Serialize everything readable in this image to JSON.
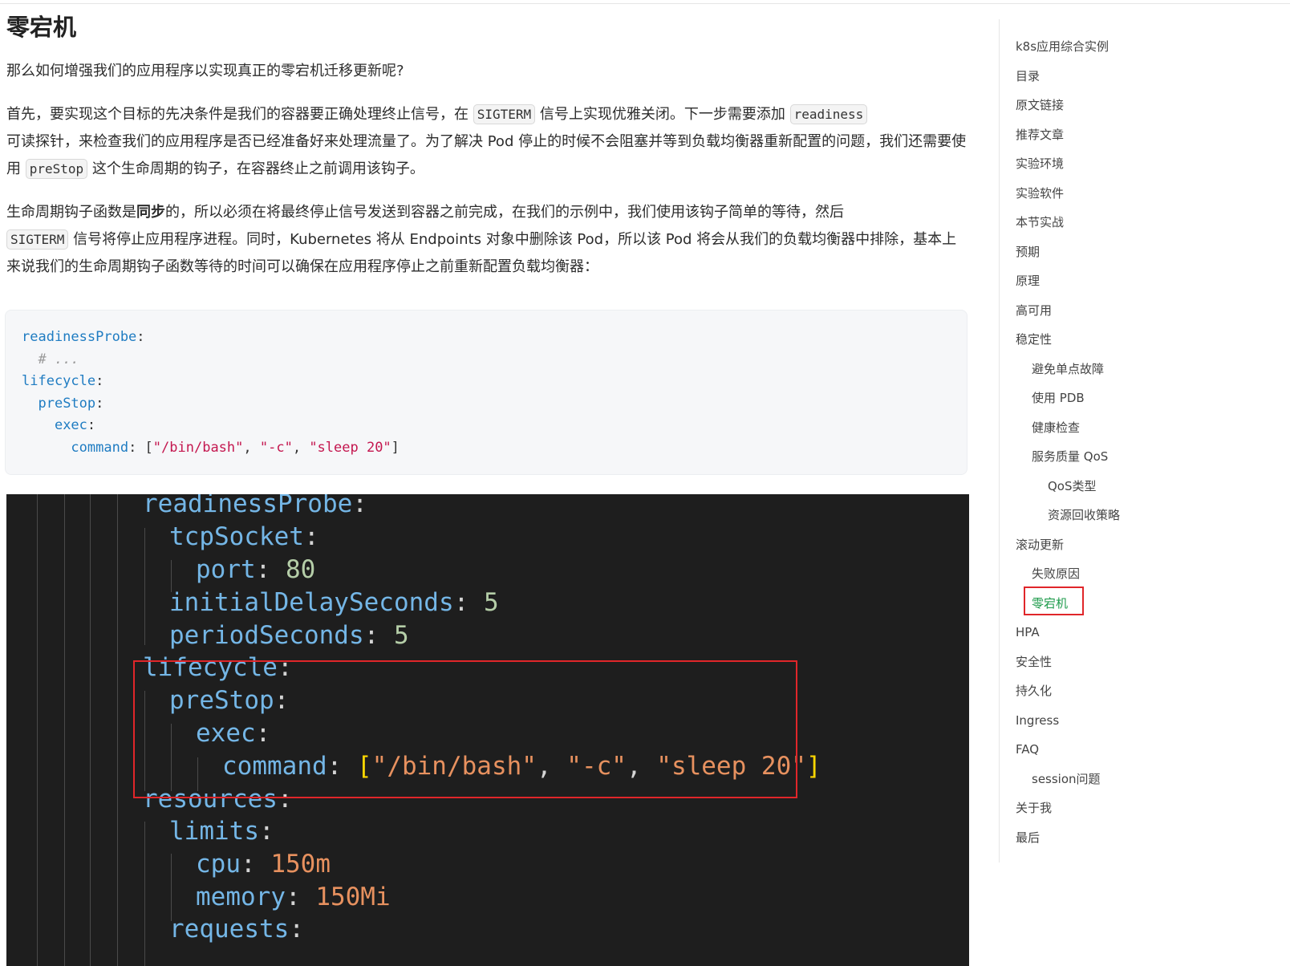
{
  "article": {
    "title": "零宕机",
    "p1": "那么如何增强我们的应用程序以实现真正的零宕机迁移更新呢?",
    "p2": {
      "t1": "首先，要实现这个目标的先决条件是我们的容器要正确处理终止信号，在 ",
      "c1": "SIGTERM",
      "t2": " 信号上实现优雅关闭。下一步需要添加 ",
      "c2": "readiness",
      "t3": "可读探针，来检查我们的应用程序是否已经准备好来处理流量了。为了解决 Pod 停止的时候不会阻塞并等到负载均衡器重新配置的问题，我们还需要使用 ",
      "c3": "preStop",
      "t4": " 这个生命周期的钩子，在容器终止之前调用该钩子。"
    },
    "p3": {
      "t1": "生命周期钩子函数是",
      "bold": "同步",
      "t2": "的，所以必须在将最终停止信号发送到容器之前完成，在我们的示例中，我们使用该钩子简单的等待，然后 ",
      "c1": "SIGTERM",
      "t3": " 信号将停止应用程序进程。同时，Kubernetes 将从 Endpoints 对象中删除该 Pod，所以该 Pod 将会从我们的负载均衡器中排除，基本上来说我们的生命周期钩子函数等待的时间可以确保在应用程序停止之前重新配置负载均衡器："
    }
  },
  "code_block": {
    "l1_key": "readinessProbe",
    "l2_comment": "# ...",
    "l3_key": "lifecycle",
    "l4_key": "preStop",
    "l5_key": "exec",
    "l6_key": "command",
    "l6_s1": "\"/bin/bash\"",
    "l6_s2": "\"-c\"",
    "l6_s3": "\"sleep 20\""
  },
  "screenshot": {
    "readinessProbe": "readinessProbe",
    "tcpSocket": "tcpSocket",
    "port": "port",
    "port_value": "80",
    "initialDelaySeconds": "initialDelaySeconds",
    "initialDelaySeconds_value": "5",
    "periodSeconds": "periodSeconds",
    "periodSeconds_value": "5",
    "lifecycle": "lifecycle",
    "preStop": "preStop",
    "exec": "exec",
    "command": "command",
    "cmd_s1": "\"/bin/bash\"",
    "cmd_s2": "\"-c\"",
    "cmd_s3": "\"sleep 20\"",
    "resources": "resources",
    "limits": "limits",
    "cpu": "cpu",
    "cpu_value": "150m",
    "memory": "memory",
    "memory_value": "150Mi",
    "requests": "requests"
  },
  "toc": {
    "items": [
      {
        "label": "k8s应用综合实例",
        "level": 0
      },
      {
        "label": "目录",
        "level": 0
      },
      {
        "label": "原文链接",
        "level": 0
      },
      {
        "label": "推荐文章",
        "level": 0
      },
      {
        "label": "实验环境",
        "level": 0
      },
      {
        "label": "实验软件",
        "level": 0
      },
      {
        "label": "本节实战",
        "level": 0
      },
      {
        "label": "预期",
        "level": 0
      },
      {
        "label": "原理",
        "level": 0
      },
      {
        "label": "高可用",
        "level": 0
      },
      {
        "label": "稳定性",
        "level": 0
      },
      {
        "label": "避免单点故障",
        "level": 1
      },
      {
        "label": "使用 PDB",
        "level": 1
      },
      {
        "label": "健康检查",
        "level": 1
      },
      {
        "label": "服务质量 QoS",
        "level": 1
      },
      {
        "label": "QoS类型",
        "level": 2
      },
      {
        "label": "资源回收策略",
        "level": 2
      },
      {
        "label": "滚动更新",
        "level": 0
      },
      {
        "label": "失败原因",
        "level": 1
      },
      {
        "label": "零宕机",
        "level": 1,
        "active": true
      },
      {
        "label": "HPA",
        "level": 0
      },
      {
        "label": "安全性",
        "level": 0
      },
      {
        "label": "持久化",
        "level": 0
      },
      {
        "label": "Ingress",
        "level": 0
      },
      {
        "label": "FAQ",
        "level": 0
      },
      {
        "label": "session问题",
        "level": 1
      },
      {
        "label": "关于我",
        "level": 0
      },
      {
        "label": "最后",
        "level": 0
      }
    ],
    "active_color": "#1f9b4c"
  }
}
